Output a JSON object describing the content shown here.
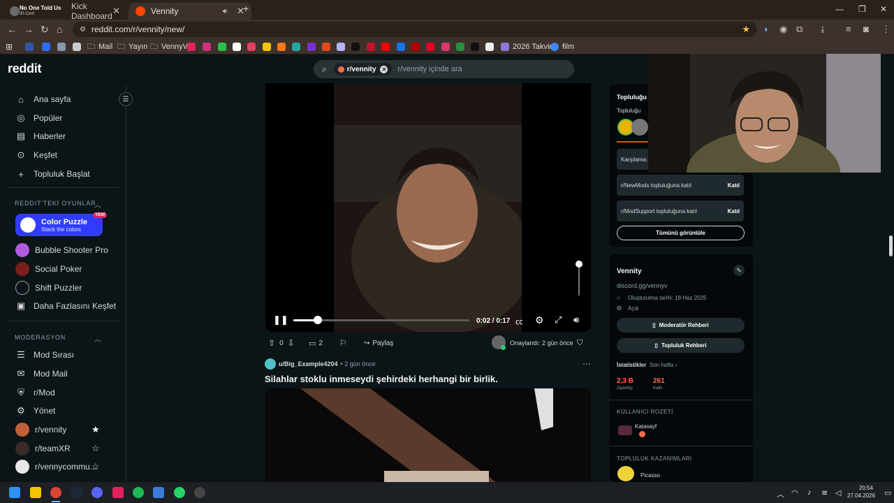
{
  "browser": {
    "tabs": [
      {
        "label": "Kick Dashboard",
        "overlay": "No One Told Us",
        "overlay_sub": "30 Cent",
        "active": false
      },
      {
        "label": "Vennity",
        "active": true
      }
    ],
    "url": "reddit.com/r/vennity/new/",
    "bookmarks": [
      "Mail",
      "Yayın",
      "VennyV",
      "2026 Takvimi",
      "film"
    ]
  },
  "reddit": {
    "logo": "reddit",
    "search": {
      "chip": "r/vennity",
      "placeholder": "r/vennity içinde ara"
    },
    "nav": [
      "Ana sayfa",
      "Popüler",
      "Haberler",
      "Keşfet",
      "Topluluk Başlat"
    ],
    "games_header": "REDDIT'TEKİ OYUNLAR",
    "games": {
      "featured": {
        "title": "Color Puzzle",
        "subtitle": "Stack the colors",
        "badge": "YENİ"
      },
      "list": [
        "Bubble Shooter Pro",
        "Social Poker",
        "Shift Puzzler",
        "Daha Fazlasını Keşfet"
      ]
    },
    "mod_header": "MODERASYON",
    "mod_items": [
      "Mod Sırası",
      "Mod Mail",
      "r/Mod",
      "Yönet"
    ],
    "communities": [
      "r/vennity",
      "r/teamXR",
      "r/vennycommu..."
    ]
  },
  "post1": {
    "video_time": "0:02 / 0:17",
    "progress": 0.14,
    "volume": 0.9,
    "votes": "0",
    "comments": "2",
    "share": "Paylaş",
    "approved": "Onaylandı: 2 gün önce"
  },
  "post2": {
    "user": "u/Big_Example4204",
    "time": "• 2 gün önce",
    "title": "Silahlar stoklu inmeseydi şehirdeki herhangi bir birlik."
  },
  "right": {
    "community_title": "Topluluğu",
    "community_sub": "Topluluğu",
    "welcome": "Karşılama p",
    "join_rows": [
      {
        "text": "r/NewMods topluluğuna katıl",
        "button": "Katıl"
      },
      {
        "text": "r/ModSupport topluluğuna katıl",
        "button": "Katıl"
      }
    ],
    "view_all": "Tümünü görüntüle",
    "sub_name": "Vennity",
    "discord": "discord.gg/vennyv",
    "created": "Oluşturulma tarihi: 18 Haz 2025",
    "visibility": "Açık",
    "mod_guide": "Moderatör Rehberi",
    "community_guide": "Topluluk Rehberi",
    "stats_label": "İstatistikler",
    "stats_period": "Son hafta ›",
    "visitors": {
      "value": "2,3 B",
      "label": "Ziyaretçi"
    },
    "contributions": {
      "value": "261",
      "label": "Katkı"
    },
    "user_badge_header": "KULLANICI ROZETİ",
    "user_badge_name": "Katasayf",
    "achievements_header": "TOPLULUK KAZANIMLARI",
    "achievement": "Picasso"
  },
  "taskbar": {
    "time": "20:54",
    "date": "27.04.2026"
  },
  "colors": {
    "bg": "#0b1416",
    "accent": "#ff4500",
    "featured": "#2f3cff",
    "stat": "#ff6b4a"
  }
}
